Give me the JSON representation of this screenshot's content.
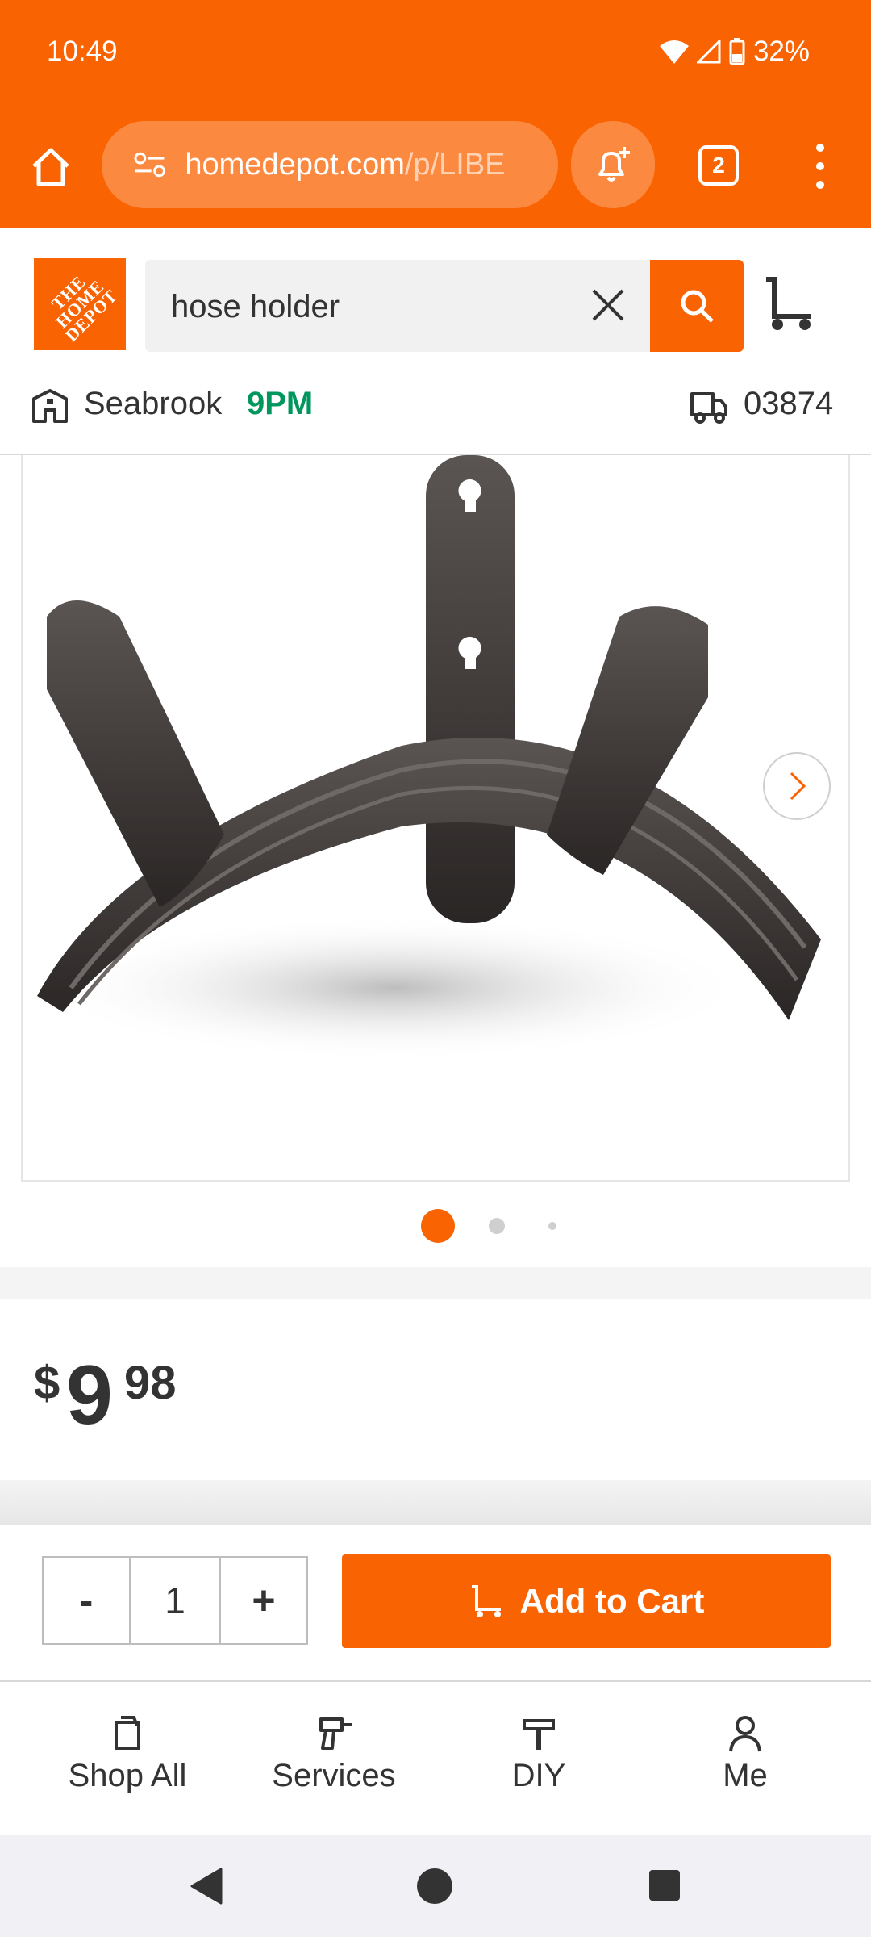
{
  "status_bar": {
    "time": "10:49",
    "battery": "32%"
  },
  "browser": {
    "url_main": "homedepot.com",
    "url_path": "/p/LIBE",
    "tab_count": "2"
  },
  "header": {
    "logo_text": "THE HOME DEPOT",
    "search_value": "hose holder",
    "store_name": "Seabrook",
    "store_hours": "9PM",
    "zip_code": "03874"
  },
  "gallery": {
    "active_index": 0,
    "total_images": 3
  },
  "price": {
    "currency": "$",
    "dollars": "9",
    "cents": "98"
  },
  "purchase": {
    "minus_label": "-",
    "quantity": "1",
    "plus_label": "+",
    "add_to_cart_label": "Add to Cart"
  },
  "bottom_nav": {
    "items": [
      {
        "label": "Shop All",
        "icon": "shop-all-icon"
      },
      {
        "label": "Services",
        "icon": "services-drill-icon"
      },
      {
        "label": "DIY",
        "icon": "diy-hammer-icon"
      },
      {
        "label": "Me",
        "icon": "person-icon"
      }
    ]
  },
  "colors": {
    "brand": "#f96302",
    "store_open": "#00965e"
  }
}
